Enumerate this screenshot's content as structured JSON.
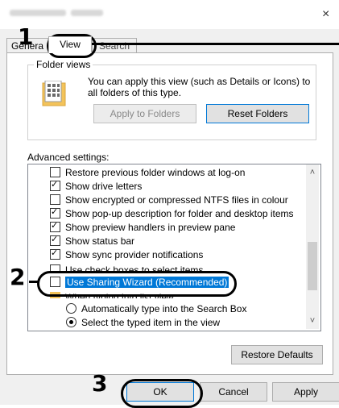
{
  "window": {
    "title_blurred": "File Explorer Options",
    "close_glyph": "×"
  },
  "tabs": [
    {
      "label": "General",
      "shown": "Genera"
    },
    {
      "label": "View"
    },
    {
      "label": "Search"
    }
  ],
  "folder_views": {
    "label": "Folder views",
    "description": "You can apply this view (such as Details or Icons) to all folders of this type.",
    "apply_label": "Apply to Folders",
    "reset_label": "Reset Folders"
  },
  "advanced": {
    "label": "Advanced settings:",
    "items": [
      {
        "label": "Restore previous folder windows at log-on",
        "checked": false
      },
      {
        "label": "Show drive letters",
        "checked": true
      },
      {
        "label": "Show encrypted or compressed NTFS files in colour",
        "checked": false
      },
      {
        "label": "Show pop-up description for folder and desktop items",
        "checked": true
      },
      {
        "label": "Show preview handlers in preview pane",
        "checked": true
      },
      {
        "label": "Show status bar",
        "checked": true
      },
      {
        "label": "Show sync provider notifications",
        "checked": true
      },
      {
        "label": "Use check boxes to select items",
        "checked": false
      },
      {
        "label": "Use Sharing Wizard (Recommended)",
        "checked": false
      },
      {
        "label": "When typing into list view"
      },
      {
        "label": "Automatically type into the Search Box",
        "checked": false
      },
      {
        "label": "Select the typed item in the view",
        "checked": true
      }
    ],
    "restore_label": "Restore Defaults"
  },
  "buttons": {
    "ok": "OK",
    "cancel": "Cancel",
    "apply": "Apply"
  },
  "annotations": {
    "step1": "1",
    "step2": "2",
    "step3": "3"
  },
  "colors": {
    "highlight": "#0078d7",
    "accent_border": "#0078d7"
  }
}
